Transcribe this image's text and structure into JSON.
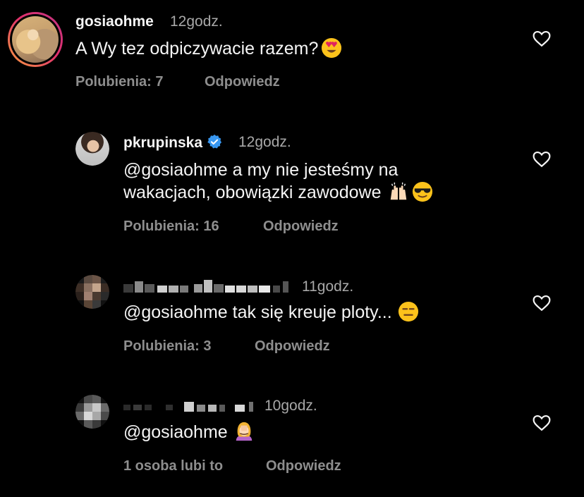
{
  "comments": [
    {
      "username": "gosiaohme",
      "time": "12godz.",
      "text": "A Wy tez odpiczywacie razem?",
      "likes": "Polubienia: 7",
      "reply": "Odpowiedz",
      "emoji": "heart-eyes-emoji"
    },
    {
      "username": "pkrupinska",
      "time": "12godz.",
      "verified": true,
      "mention": "@gosiaohme",
      "text_line1": " a my nie jesteśmy na",
      "text_line2": "wakacjach, obowiązki zawodowe",
      "likes": "Polubienia: 16",
      "reply": "Odpowiedz",
      "emojis": [
        "raising-hands-emoji",
        "sunglasses-emoji"
      ]
    },
    {
      "username_blurred": true,
      "time": "11godz.",
      "mention": "@gosiaohme",
      "text": " tak się kreuje ploty...",
      "likes": "Polubienia: 3",
      "reply": "Odpowiedz",
      "emoji": "expressionless-emoji"
    },
    {
      "username_blurred": true,
      "time": "10godz.",
      "mention": "@gosiaohme",
      "text": "",
      "likes": "1 osoba lubi to",
      "reply": "Odpowiedz",
      "emoji": "facepalm-emoji"
    }
  ],
  "colors": {
    "background": "#000000",
    "primary_text": "#f5f5f5",
    "secondary_text": "#8e8e8e",
    "verified_blue": "#3897f0"
  },
  "icons": {
    "like": "heart-outline-icon",
    "verified": "verified-badge-icon"
  }
}
